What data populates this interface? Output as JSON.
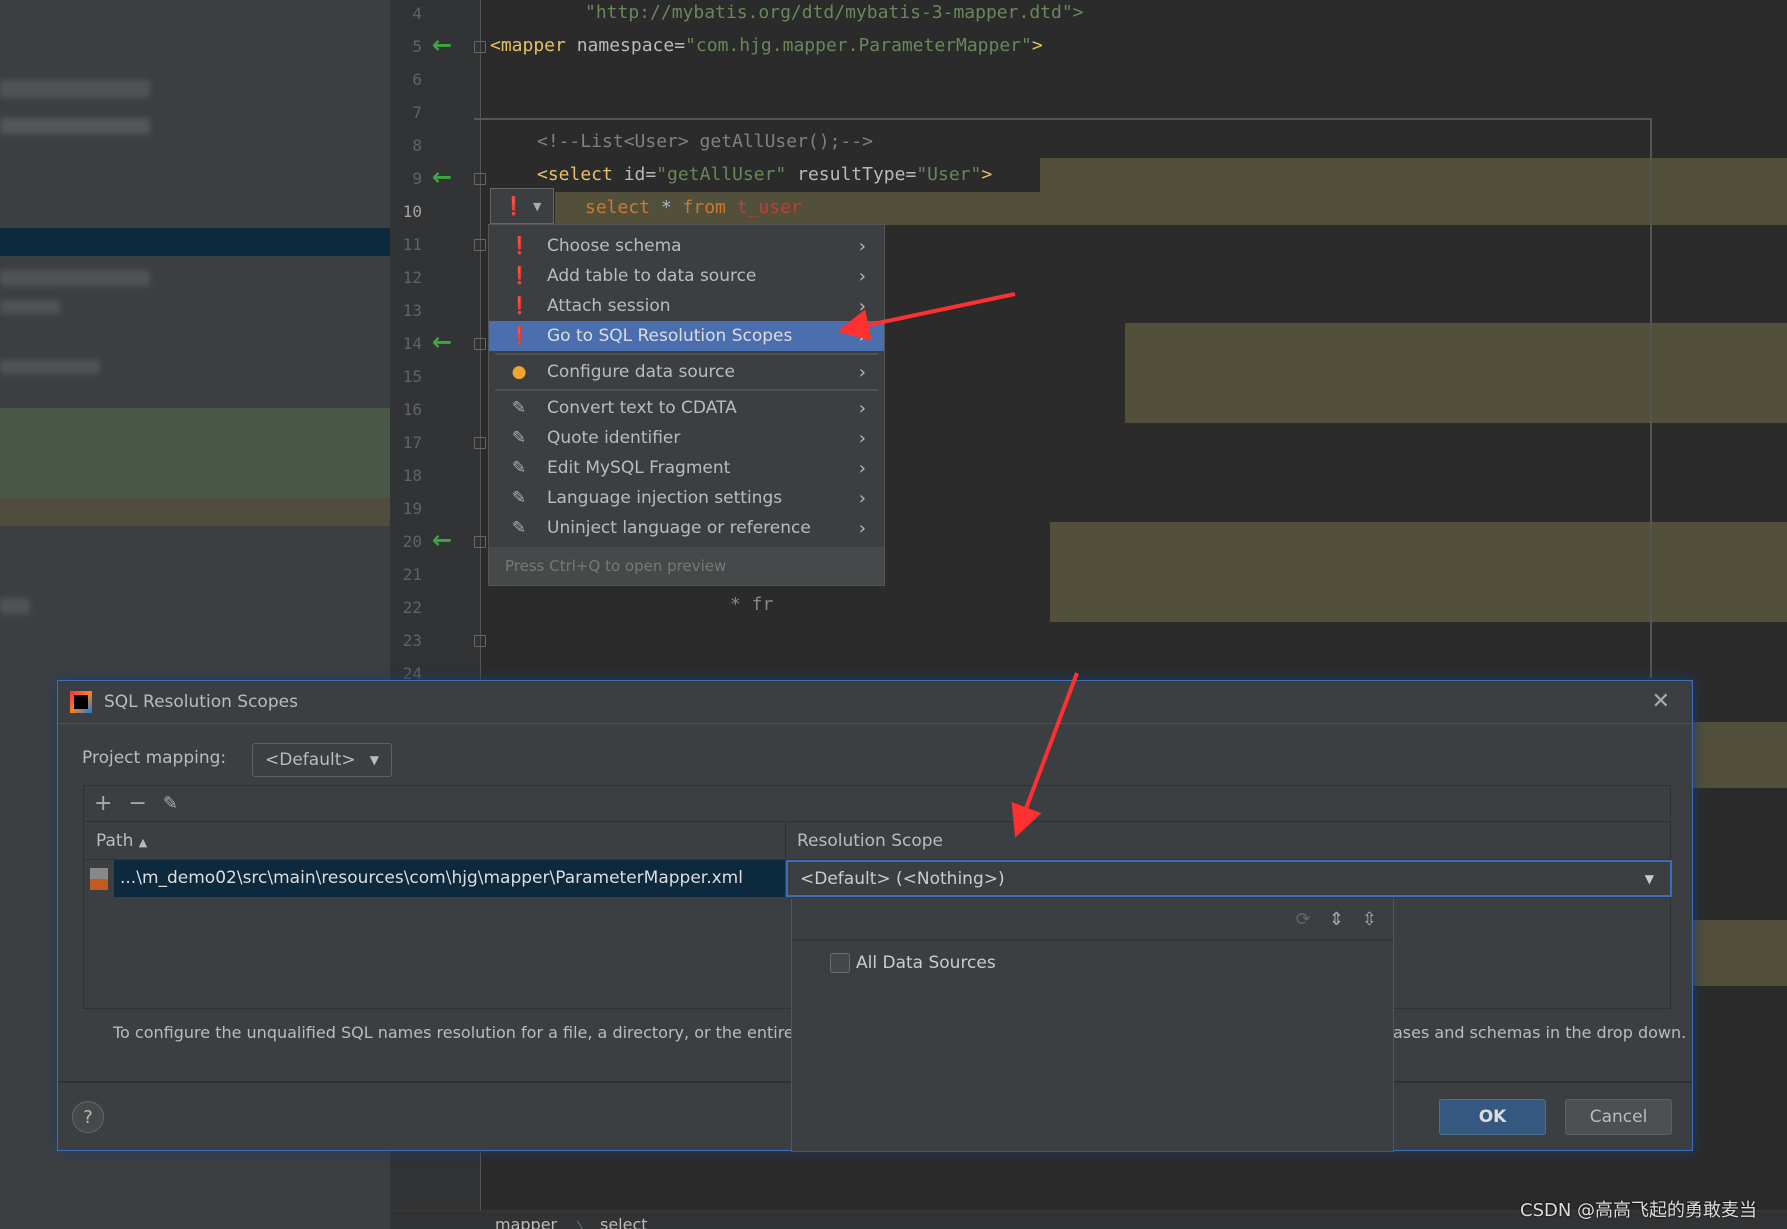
{
  "editor": {
    "line_numbers": [
      "4",
      "5",
      "6",
      "7",
      "8",
      "9",
      "10",
      "11",
      "12",
      "13",
      "14",
      "15",
      "16",
      "17",
      "18",
      "19",
      "20",
      "21",
      "22",
      "23",
      "24"
    ],
    "current_line": "10",
    "lines": {
      "l4": "\"http://mybatis.org/dtd/mybatis-3-mapper.dtd\">",
      "l5_tag": "<mapper",
      "l5_attr": " namespace=",
      "l5_str": "\"com.hjg.mapper.ParameterMapper\"",
      "l5_end": ">",
      "l8": "<!--List<User> getAllUser();-->",
      "l9_tag": "<select",
      "l9_attr1": " id=",
      "l9_str1": "\"getAllUser\"",
      "l9_attr2": " resultType=",
      "l9_str2": "\"User\"",
      "l9_end": ">",
      "l10_kw1": "select",
      "l10_star": " * ",
      "l10_kw2": "from",
      "l10_tbl": " t_user",
      "l22": "* fr"
    },
    "breadcrumb": [
      "mapper",
      "select"
    ],
    "breadcrumb_sep": "〉"
  },
  "intention_menu": {
    "items": [
      {
        "label": "Choose schema",
        "icon": "error-bulb-icon"
      },
      {
        "label": "Add table to data source",
        "icon": "error-bulb-icon"
      },
      {
        "label": "Attach session",
        "icon": "error-bulb-icon"
      },
      {
        "label": "Go to SQL Resolution Scopes",
        "icon": "error-bulb-icon",
        "selected": true
      },
      {
        "label": "Configure data source",
        "icon": "yellow-bulb-icon"
      },
      {
        "label": "Convert text to CDATA",
        "icon": "edit-intention-icon"
      },
      {
        "label": "Quote identifier",
        "icon": "edit-intention-icon"
      },
      {
        "label": "Edit MySQL Fragment",
        "icon": "edit-intention-icon"
      },
      {
        "label": "Language injection settings",
        "icon": "edit-intention-icon"
      },
      {
        "label": "Uninject language or reference",
        "icon": "edit-intention-icon"
      }
    ],
    "hint": "Press Ctrl+Q to open preview"
  },
  "dialog": {
    "title": "SQL Resolution Scopes",
    "project_mapping_label": "Project mapping:",
    "project_mapping_value": "<Default>",
    "columns": [
      "Path",
      "Resolution Scope"
    ],
    "rows": [
      {
        "path": "...\\m_demo02\\src\\main\\resources\\com\\hjg\\mapper\\ParameterMapper.xml",
        "scope": "<Default> (<Nothing>)"
      }
    ],
    "dropdown_option": "All Data Sources",
    "description_left": "To configure the unqualified SQL names resolution for a file, a directory, or the entire pro",
    "description_right": "ases and schemas in the drop down.",
    "ok": "OK",
    "cancel": "Cancel",
    "help": "?"
  },
  "watermark": "CSDN @高高飞起的勇敢麦当",
  "colors": {
    "accent": "#4b6eaf",
    "annotation_arrow": "#ff3030",
    "selected_row": "#0d293e"
  }
}
